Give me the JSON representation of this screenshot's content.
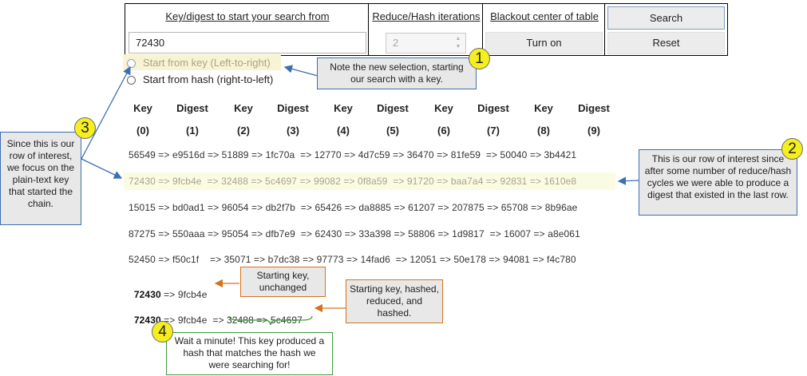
{
  "controls": {
    "key_header": "Key/digest to start your search from",
    "key_value": "72430",
    "iterations_header": "Reduce/Hash iterations",
    "iterations_value": "2",
    "blackout_header": "Blackout center of table",
    "turn_on_label": "Turn on",
    "search_label": "Search",
    "reset_label": "Reset",
    "radio_key_label": "Start from key (Left-to-right)",
    "radio_hash_label": "Start from hash (right-to-left)"
  },
  "table": {
    "headers": [
      {
        "name": "Key",
        "index": "(0)"
      },
      {
        "name": "Digest",
        "index": "(1)"
      },
      {
        "name": "Key",
        "index": "(2)"
      },
      {
        "name": "Digest",
        "index": "(3)"
      },
      {
        "name": "Key",
        "index": "(4)"
      },
      {
        "name": "Digest",
        "index": "(5)"
      },
      {
        "name": "Key",
        "index": "(6)"
      },
      {
        "name": "Digest",
        "index": "(7)"
      },
      {
        "name": "Key",
        "index": "(8)"
      },
      {
        "name": "Digest",
        "index": "(9)"
      }
    ],
    "rows": [
      "56549 => e9516d => 51889 => 1fc70a  => 12770 => 4d7c59 => 36470 => 81fe59  => 50040 => 3b4421",
      "72430 => 9fcb4e  => 32488 => 5c4697 => 99082 => 0f8a59  => 91720 => baa7a4 => 92831 => 1610e8",
      "15015 => bd0ad1 => 96054 => db2f7b  => 65426 => da8885 => 61207 => 207875 => 65708 => 8b96ae",
      "87275 => 550aaa => 95054 => dfb7e9  => 62430 => 33a398 => 58806 => 1d9817  => 16007 => a8e061",
      "52450 => f50c1f    => 35071 => b7dc38 => 97773 => 14fad6  => 12051 => 50e178 => 94081 => f4c780"
    ],
    "highlight_color": "#fafbe3"
  },
  "results": [
    {
      "key": "72430",
      "rest": " => 9fcb4e"
    },
    {
      "key": "72430",
      "rest": " => 9fcb4e  => 32488 => 5c4697"
    }
  ],
  "callouts": {
    "c1_number": "1",
    "c1_text": "Note the new selection, starting our search with a key.",
    "c2_number": "2",
    "c2_text": "This is our row of interest since after some number of reduce/hash cycles we were able to produce a digest that existed in the last row.",
    "c3_number": "3",
    "c3_text": "Since this is our row of interest, we focus on the plain-text key that started the chain.",
    "c4_number": "4",
    "c4_text": "Wait a minute! This key produced a hash that matches the hash we were searching for!",
    "starting_key_unchanged": "Starting key, unchanged",
    "starting_key_hashed": "Starting key, hashed, reduced, and hashed."
  },
  "colors": {
    "blue": "#3c6fb0",
    "orange": "#d5731c",
    "green": "#3e9a3e",
    "badge": "#f5ef1e"
  }
}
